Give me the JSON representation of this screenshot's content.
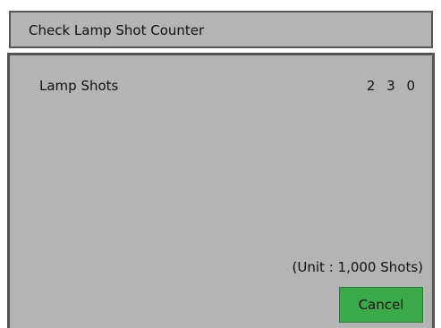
{
  "dialog": {
    "title": "Check Lamp Shot Counter"
  },
  "lamp_shots": {
    "label": "Lamp Shots",
    "value": "2 3 0"
  },
  "unit_note": "(Unit : 1,000 Shots)",
  "buttons": {
    "cancel_label": "Cancel"
  },
  "colors": {
    "panel_background": "#b4b4b4",
    "border": "#555555",
    "cancel_button": "#3aaa48"
  }
}
